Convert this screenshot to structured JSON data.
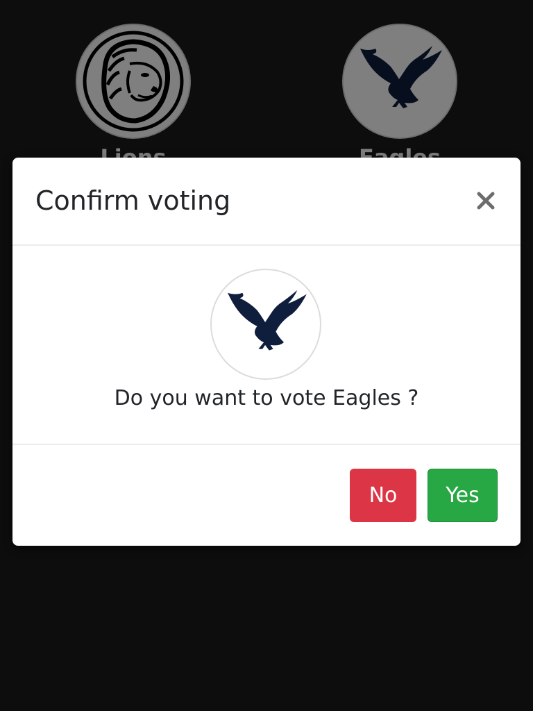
{
  "teams": [
    {
      "name": "Lions",
      "logo_icon": "lion-icon"
    },
    {
      "name": "Eagles",
      "logo_icon": "eagle-icon"
    }
  ],
  "modal": {
    "title": "Confirm voting",
    "close_icon": "close-icon",
    "selected_logo_icon": "eagle-icon",
    "question": "Do you want to vote Eagles ?",
    "no_label": "No",
    "yes_label": "Yes"
  },
  "colors": {
    "background": "#1a1a1a",
    "eagle": "#0f1e3d",
    "no_button": "#dc3545",
    "yes_button": "#28a745"
  }
}
